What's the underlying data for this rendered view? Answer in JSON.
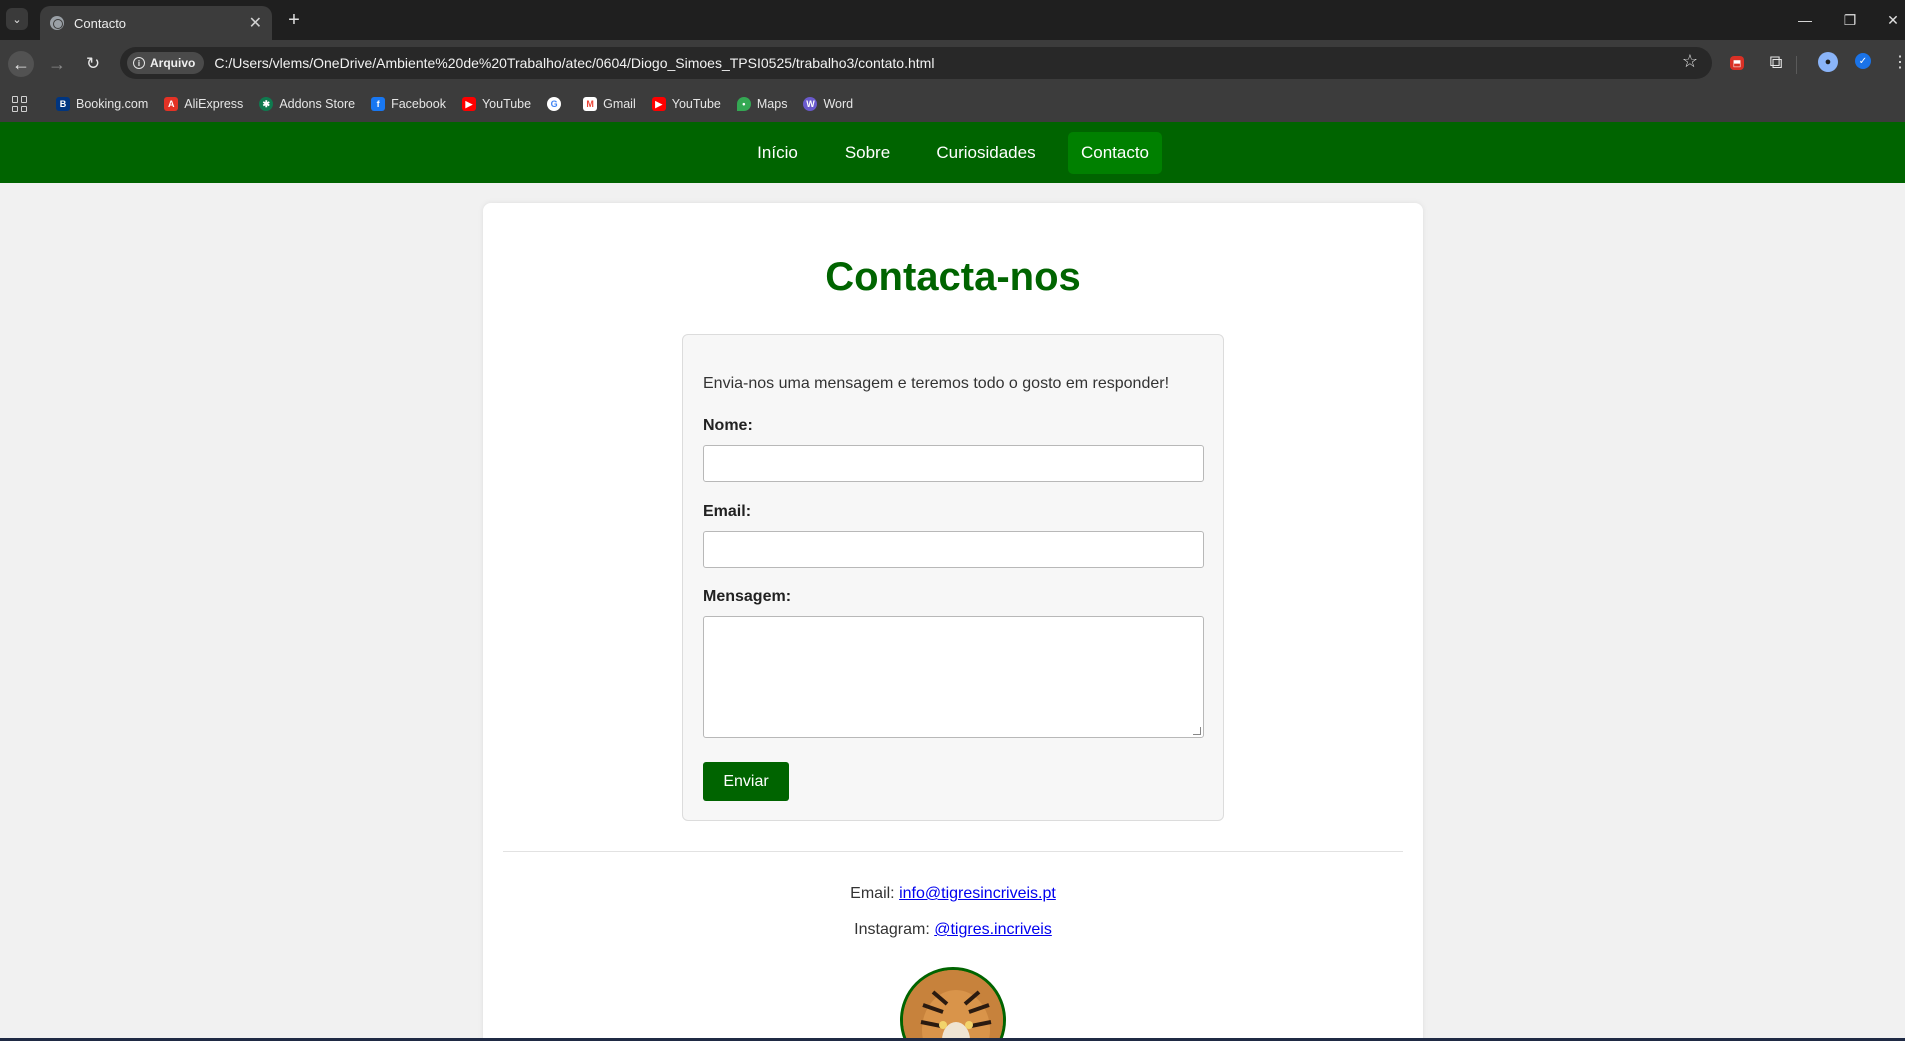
{
  "browser": {
    "tab_title": "Contacto",
    "site_chip": "Arquivo",
    "url": "C:/Users/vlems/OneDrive/Ambiente%20de%20Trabalho/atec/0604/Diogo_Simoes_TPSI0525/trabalho3/contato.html",
    "bookmarks": [
      {
        "label": "Booking.com",
        "icon": "booking-icon",
        "color": "#003580"
      },
      {
        "label": "AliExpress",
        "icon": "aliexpress-icon",
        "color": "#e43225"
      },
      {
        "label": "Addons Store",
        "icon": "addons-store-icon",
        "color": "#0f7a4f"
      },
      {
        "label": "Facebook",
        "icon": "facebook-icon",
        "color": "#1877f2"
      },
      {
        "label": "YouTube",
        "icon": "youtube-icon",
        "color": "#ff0000"
      },
      {
        "label": "",
        "icon": "google-icon",
        "color": "#ffffff"
      },
      {
        "label": "Gmail",
        "icon": "gmail-icon",
        "color": "#ea4335"
      },
      {
        "label": "YouTube",
        "icon": "youtube-icon",
        "color": "#ff0000"
      },
      {
        "label": "Maps",
        "icon": "maps-icon",
        "color": "#34a853"
      },
      {
        "label": "Word",
        "icon": "word-icon",
        "color": "#6a5acd"
      }
    ]
  },
  "site_nav": {
    "items": [
      "Início",
      "Sobre",
      "Curiosidades",
      "Contacto"
    ],
    "active": "Contacto",
    "color": "#006400",
    "active_color": "#008000"
  },
  "page": {
    "title": "Contacta-nos",
    "intro": "Envia-nos uma mensagem e teremos todo o gosto em responder!",
    "labels": {
      "name": "Nome:",
      "email": "Email:",
      "message": "Mensagem:"
    },
    "values": {
      "name": "",
      "email": "",
      "message": ""
    },
    "submit_label": "Enviar",
    "footer": {
      "email_label": "Email:",
      "email_value": "info@tigresincriveis.pt",
      "instagram_label": "Instagram:",
      "instagram_value": "@tigres.incriveis",
      "logo_icon": "tiger-logo-icon"
    }
  }
}
